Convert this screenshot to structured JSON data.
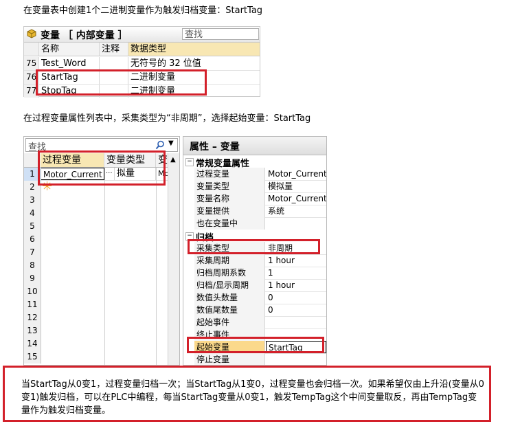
{
  "intro1": "在变量表中创建1个二进制变量作为触发归档变量：StartTag",
  "tag_table": {
    "title": "变量 ［ 内部变量 ］",
    "search_placeholder": "查找",
    "col_name": "名称",
    "col_comment": "注释",
    "col_type": "数据类型",
    "rows": [
      {
        "num": "75",
        "name": "Test_Word",
        "type": "无符号的 32 位值"
      },
      {
        "num": "76",
        "name": "StartTag",
        "type": "二进制变量"
      },
      {
        "num": "77",
        "name": "StopTag",
        "type": "二进制变量"
      }
    ]
  },
  "intro2": "在过程变量属性列表中，采集类型为“非周期”，选择起始变量：StartTag",
  "var_grid": {
    "search_placeholder": "查找",
    "col_process": "过程变量",
    "col_vartype": "变量类型",
    "col_extra": "变",
    "row1": {
      "process": "Motor_Current",
      "ellipsis": "···",
      "vartype": "拟量",
      "extra": "Mo"
    },
    "new_row_icon": "asterisk",
    "row_numbers": [
      "1",
      "2",
      "3",
      "4",
      "5",
      "6",
      "7",
      "8",
      "9",
      "10",
      "11",
      "12",
      "13",
      "14",
      "15"
    ]
  },
  "properties": {
    "title": "属性 – 变量",
    "section_general": "常规变量属性",
    "general_rows": [
      {
        "k": "过程变量",
        "v": "Motor_Current"
      },
      {
        "k": "变量类型",
        "v": "模拟量"
      },
      {
        "k": "变量名称",
        "v": "Motor_Current"
      },
      {
        "k": "变量提供",
        "v": "系统"
      },
      {
        "k": "也在变量中",
        "v": ""
      }
    ],
    "section_archive": "归档",
    "archive_rows": [
      {
        "k": "采集类型",
        "v": "非周期"
      },
      {
        "k": "采集周期",
        "v": "1 hour"
      },
      {
        "k": "归档周期系数",
        "v": "1"
      },
      {
        "k": "归档/显示周期",
        "v": "1 hour"
      },
      {
        "k": "数值头数量",
        "v": "0"
      },
      {
        "k": "数值尾数量",
        "v": "0"
      },
      {
        "k": "起始事件",
        "v": ""
      },
      {
        "k": "终止事件",
        "v": ""
      },
      {
        "k": "起始变量",
        "v": "StartTag"
      },
      {
        "k": "停止变量",
        "v": ""
      }
    ]
  },
  "note": "当StartTag从0变1，过程变量归档一次；当StartTag从1变0，过程变量也会归档一次。如果希望仅由上升沿(变量从0变1)触发归档，可以在PLC中编程，每当StartTag变量从0变1，触发TempTag这个中间变量取反，再由TempTag变量作为触发归档变量。",
  "colors": {
    "highlight_red": "#d3202a",
    "header_yellow": "#f8e7b3",
    "selected_orange": "#fbd98b"
  }
}
